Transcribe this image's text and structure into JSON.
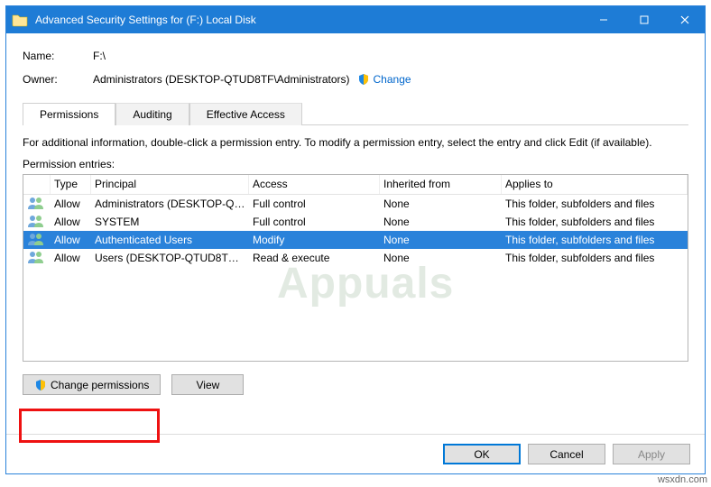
{
  "window": {
    "title": "Advanced Security Settings for (F:) Local Disk"
  },
  "info": {
    "name_label": "Name:",
    "name_value": "F:\\",
    "owner_label": "Owner:",
    "owner_value": "Administrators (DESKTOP-QTUD8TF\\Administrators)",
    "change_link": "Change"
  },
  "tabs": {
    "permissions": "Permissions",
    "auditing": "Auditing",
    "effective": "Effective Access"
  },
  "hint": "For additional information, double-click a permission entry. To modify a permission entry, select the entry and click Edit (if available).",
  "entries_label": "Permission entries:",
  "columns": {
    "type": "Type",
    "principal": "Principal",
    "access": "Access",
    "inherited": "Inherited from",
    "applies": "Applies to"
  },
  "rows": [
    {
      "type": "Allow",
      "principal": "Administrators (DESKTOP-QT...",
      "access": "Full control",
      "inherited": "None",
      "applies": "This folder, subfolders and files",
      "selected": false
    },
    {
      "type": "Allow",
      "principal": "SYSTEM",
      "access": "Full control",
      "inherited": "None",
      "applies": "This folder, subfolders and files",
      "selected": false
    },
    {
      "type": "Allow",
      "principal": "Authenticated Users",
      "access": "Modify",
      "inherited": "None",
      "applies": "This folder, subfolders and files",
      "selected": true
    },
    {
      "type": "Allow",
      "principal": "Users (DESKTOP-QTUD8TF\\Us...",
      "access": "Read & execute",
      "inherited": "None",
      "applies": "This folder, subfolders and files",
      "selected": false
    }
  ],
  "buttons": {
    "change_perm": "Change permissions",
    "view": "View",
    "ok": "OK",
    "cancel": "Cancel",
    "apply": "Apply"
  },
  "watermark": "Appuals",
  "site": "wsxdn.com"
}
